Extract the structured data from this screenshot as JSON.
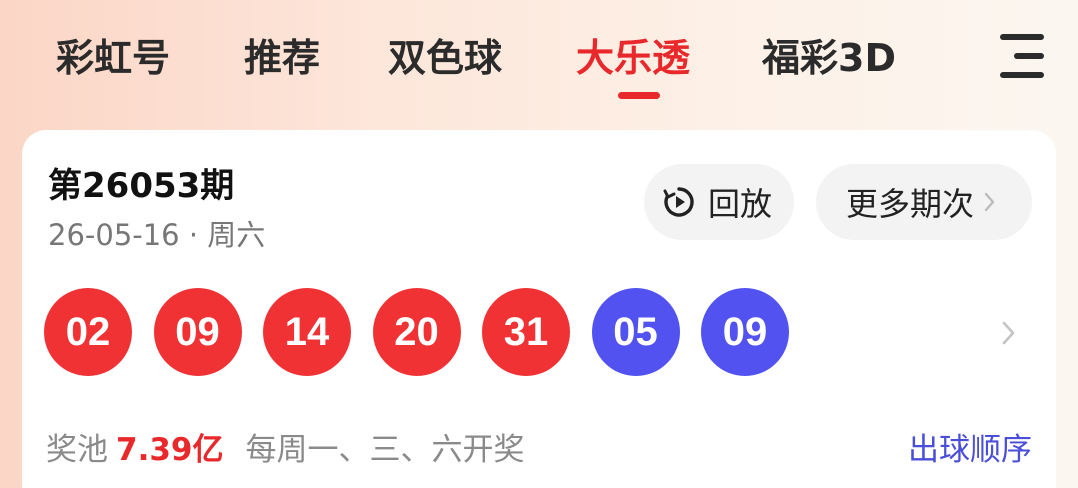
{
  "tabs": [
    {
      "label": "彩虹号"
    },
    {
      "label": "推荐"
    },
    {
      "label": "双色球"
    },
    {
      "label": "大乐透"
    },
    {
      "label": "福彩3D"
    }
  ],
  "active_tab": "大乐透",
  "menu_icon": "menu-icon",
  "draw": {
    "issue": "第26053期",
    "date": "26-05-16 · 周六",
    "replay_label": "回放",
    "more_label": "更多期次",
    "red_balls": [
      "02",
      "09",
      "14",
      "20",
      "31"
    ],
    "blue_balls": [
      "05",
      "09"
    ],
    "pool_label": "奖池",
    "pool_amount": "7.39亿",
    "schedule": "每周一、三、六开奖",
    "order_link": "出球顺序"
  },
  "colors": {
    "accent_red": "#e8282b",
    "red_ball": "#f03235",
    "blue_ball": "#5152ef",
    "link_blue": "#4a4ed8"
  }
}
